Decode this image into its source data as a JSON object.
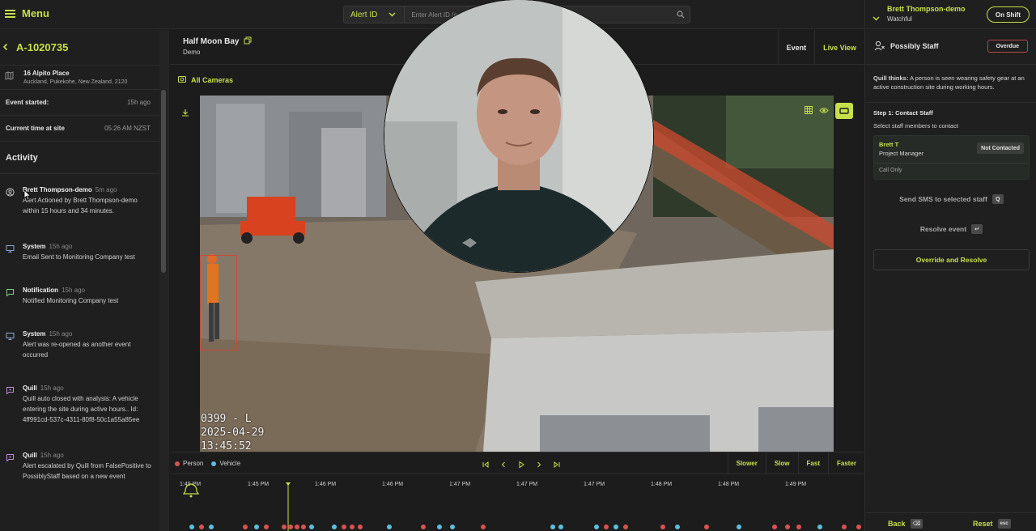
{
  "topbar": {
    "menu_label": "Menu",
    "search_type": "Alert ID",
    "search_placeholder": "Enter Alert ID (e.g. A-..."
  },
  "alert": {
    "id": "A-1020735",
    "address_line1": "16 Alpito Place",
    "address_line2": "Auckland, Pukekohe, New Zealand, 2120",
    "event_started_label": "Event started:",
    "event_started_value": "15h ago",
    "current_time_label": "Current time at site",
    "current_time_value": "05:26 AM NZST",
    "activity_title": "Activity"
  },
  "activity": [
    {
      "actor": "Brett Thompson-demo",
      "time": "5m ago",
      "text": "Alert Actioned by Brett Thompson-demo within 15 hours and 34 minutes.",
      "icon": "user-circle-icon"
    },
    {
      "actor": "System",
      "time": "15h ago",
      "text": "Email Sent to Monitoring Company test",
      "icon": "monitor-icon"
    },
    {
      "actor": "Notification",
      "time": "15h ago",
      "text": "Notified Monitoring Company test",
      "icon": "message-icon"
    },
    {
      "actor": "System",
      "time": "15h ago",
      "text": "Alert was re-opened as another event occurred",
      "icon": "monitor-icon"
    },
    {
      "actor": "Quill",
      "time": "15h ago",
      "text": "Quill auto closed with analysis: A vehicle entering the site during active hours.. Id: 4ff991cd-537c-4311-80f8-50c1a55a85ee",
      "icon": "quill-icon"
    },
    {
      "actor": "Quill",
      "time": "15h ago",
      "text": "Alert escalated by Quill from FalsePositive to PossiblyStaff based on a new event",
      "icon": "quill-icon"
    }
  ],
  "site": {
    "name": "Half Moon Bay",
    "org": "Demo",
    "tab_event": "Event",
    "tab_live": "Live View",
    "all_cameras": "All Cameras"
  },
  "video": {
    "overlay_line1": "0399 - L",
    "overlay_line2": "2025-04-29",
    "overlay_line3": "13:45:52"
  },
  "timeline": {
    "legend": [
      {
        "label": "Person",
        "color": "#d9534f"
      },
      {
        "label": "Vehicle",
        "color": "#5bc0de"
      }
    ],
    "speeds": [
      "Slower",
      "Slow",
      "Fast",
      "Faster"
    ],
    "ticks": [
      "1:45 PM",
      "1:45 PM",
      "1:46 PM",
      "1:46 PM",
      "1:47 PM",
      "1:47 PM",
      "1:47 PM",
      "1:48 PM",
      "1:48 PM",
      "1:49 PM"
    ]
  },
  "right": {
    "user_name": "Brett Thompson-demo",
    "user_status": "Watchful",
    "shift_label": "On Shift",
    "classification": "Possibly Staff",
    "overdue_label": "Overdue",
    "quill_label": "Quill thinks:",
    "quill_text": " A person is seen wearing safety gear at an active construction site during working hours.",
    "step_title": "Step 1: Contact Staff",
    "step_sub": "Select staff members to contact",
    "staff_name": "Brett T",
    "staff_role": "Project Manager",
    "staff_status": "Not Contacted",
    "staff_note": "Call Only",
    "sms_label": "Send SMS to selected staff",
    "sms_key": "Q",
    "resolve_label": "Resolve event",
    "resolve_key": "↵",
    "override_label": "Override and Resolve",
    "back_label": "Back",
    "back_key": "⌫",
    "reset_label": "Reset",
    "reset_key": "esc"
  },
  "colors": {
    "accent": "#c6e04a",
    "danger": "#b5484a",
    "person": "#d9534f",
    "vehicle": "#5bc0de"
  }
}
